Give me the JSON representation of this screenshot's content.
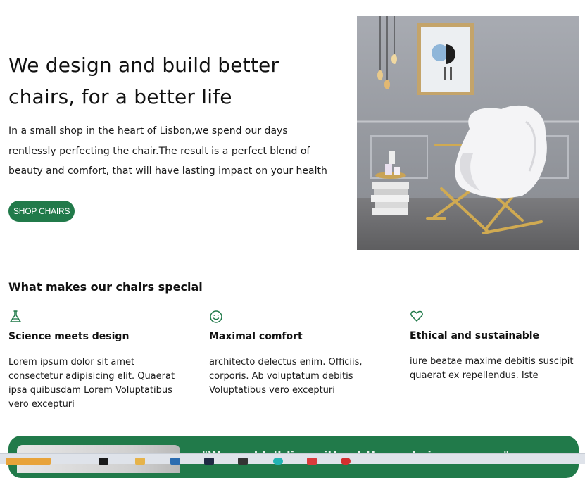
{
  "hero": {
    "title_line1": "We design and build better",
    "title_line2": "chairs, for a better life",
    "paragraph_line1": "In a small shop in the heart of Lisbon,we spend our days",
    "paragraph_line2": "rentlessly perfecting the chair.The result is a perfect blend of",
    "paragraph_line3": "beauty and comfort, that will have lasting impact on your health",
    "cta_label": "SHOP CHAIRS"
  },
  "features": {
    "title": "What makes our chairs special",
    "items": [
      {
        "icon": "flask-icon",
        "title": "Science meets design",
        "text": "Lorem ipsum dolor sit amet consectetur adipisicing elit. Quaerat ipsa quibusdam Lorem Voluptatibus vero excepturi"
      },
      {
        "icon": "smile-icon",
        "title": "Maximal comfort",
        "text": "architecto delectus enim. Officiis, corporis. Ab voluptatum debitis Voluptatibus vero excepturi"
      },
      {
        "icon": "heart-icon",
        "title": "Ethical and sustainable",
        "text": "iure beatae maxime debitis suscipit quaerat ex repellendus. Iste"
      }
    ]
  },
  "testimonial": {
    "quote": "\"We couldn't live without these chairs anymore\""
  },
  "colors": {
    "brand_green": "#217a4a",
    "text": "#111111",
    "background": "#ffffff"
  },
  "taskbar": {
    "icons": [
      "app-icon",
      "app-icon",
      "app-icon",
      "app-icon",
      "app-icon",
      "app-icon",
      "app-icon",
      "app-icon",
      "app-icon"
    ]
  }
}
